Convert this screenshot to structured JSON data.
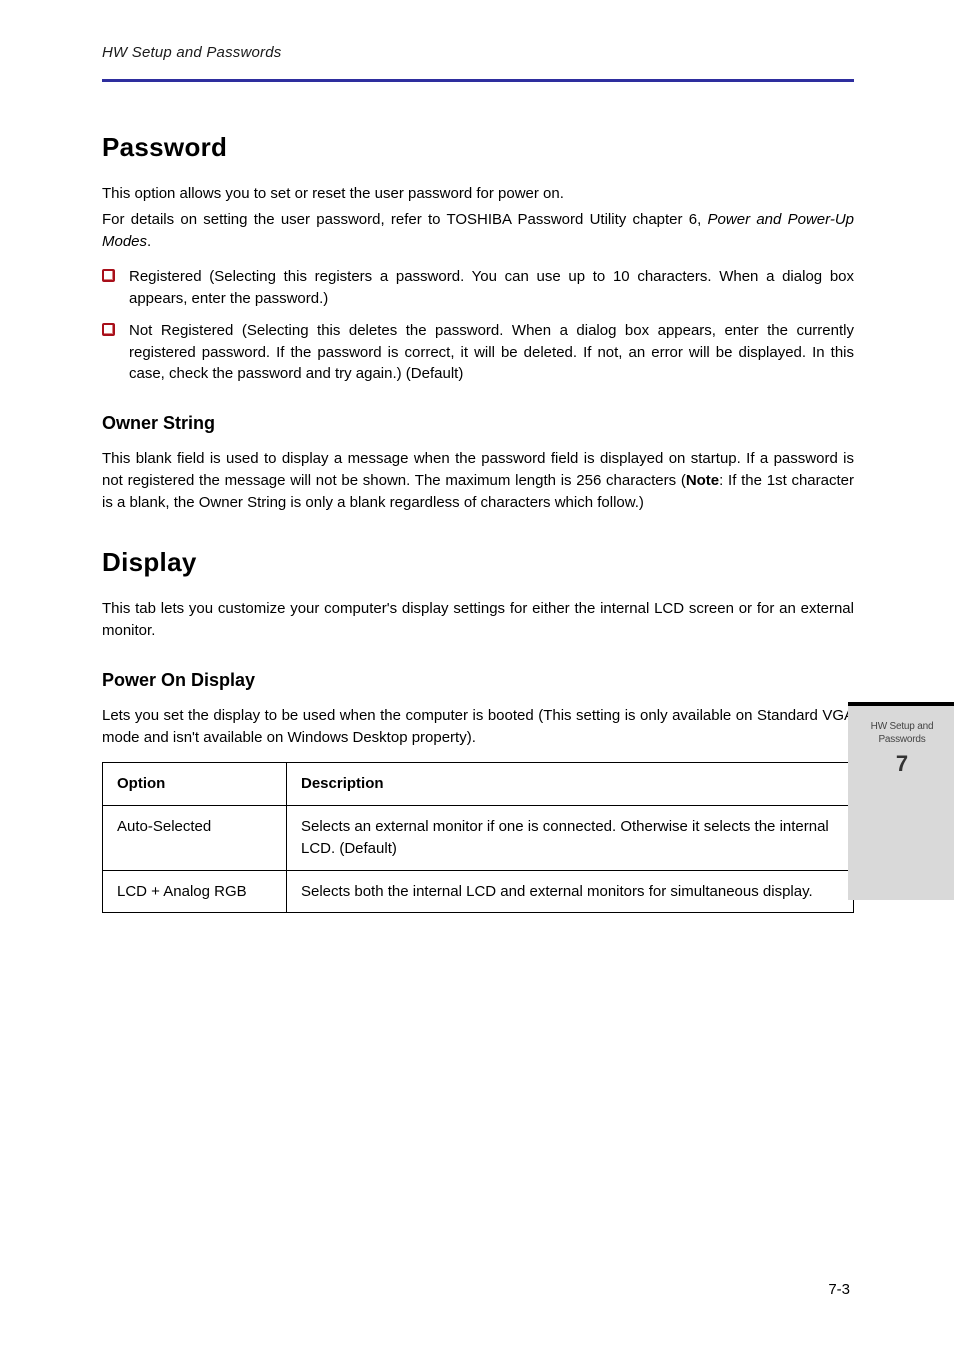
{
  "header": {
    "text": "HW Setup and Passwords"
  },
  "section": {
    "title": "Password"
  },
  "paragraphs": {
    "p1": "This option allows you to set or reset the user password for power on.",
    "p2_1": "For details on setting the user password, refer to TOSHIBA Password Utility chapter 6, ",
    "p2_link": "Power and Power-Up Modes",
    "p2_2": "."
  },
  "bullets": [
    "Registered (Selecting this registers a password. You can use up to 10 characters. When a dialog box appears, enter the password.)",
    "Not Registered (Selecting this deletes the password. When a dialog box appears, enter the currently registered password. If the password is correct, it will be deleted. If not, an error will be displayed. In this case, check the password and try again.) (Default)"
  ],
  "owner_string": {
    "title": "Owner String",
    "body_1": "This blank field is used to display a message when the password field is displayed on startup. If a password is not registered the message will not be shown. The maximum length is 256 characters (",
    "body_note": "Note",
    "body_2": ": If the 1st character is a blank, the Owner String is only a blank regardless of characters which follow.)"
  },
  "display": {
    "title": "Display",
    "body": "This tab lets you customize your computer's display settings for either the internal LCD screen or for an external monitor."
  },
  "power_on": {
    "title": "Power On Display",
    "body": "Lets you set the display to be used when the computer is booted (This setting is only available on Standard VGA mode and isn't available on Windows Desktop property)."
  },
  "table": {
    "headers": [
      "Option",
      "Description"
    ],
    "rows": [
      [
        "Auto-Selected",
        "Selects an external monitor if one is connected. Otherwise it selects the internal LCD. (Default)"
      ],
      [
        "LCD + Analog RGB",
        "Selects both the internal LCD and external monitors for simultaneous display."
      ]
    ]
  },
  "tab": {
    "line1": "HW Setup and",
    "line2": "Passwords",
    "number": "7"
  },
  "footer": {
    "page": "7-3"
  }
}
